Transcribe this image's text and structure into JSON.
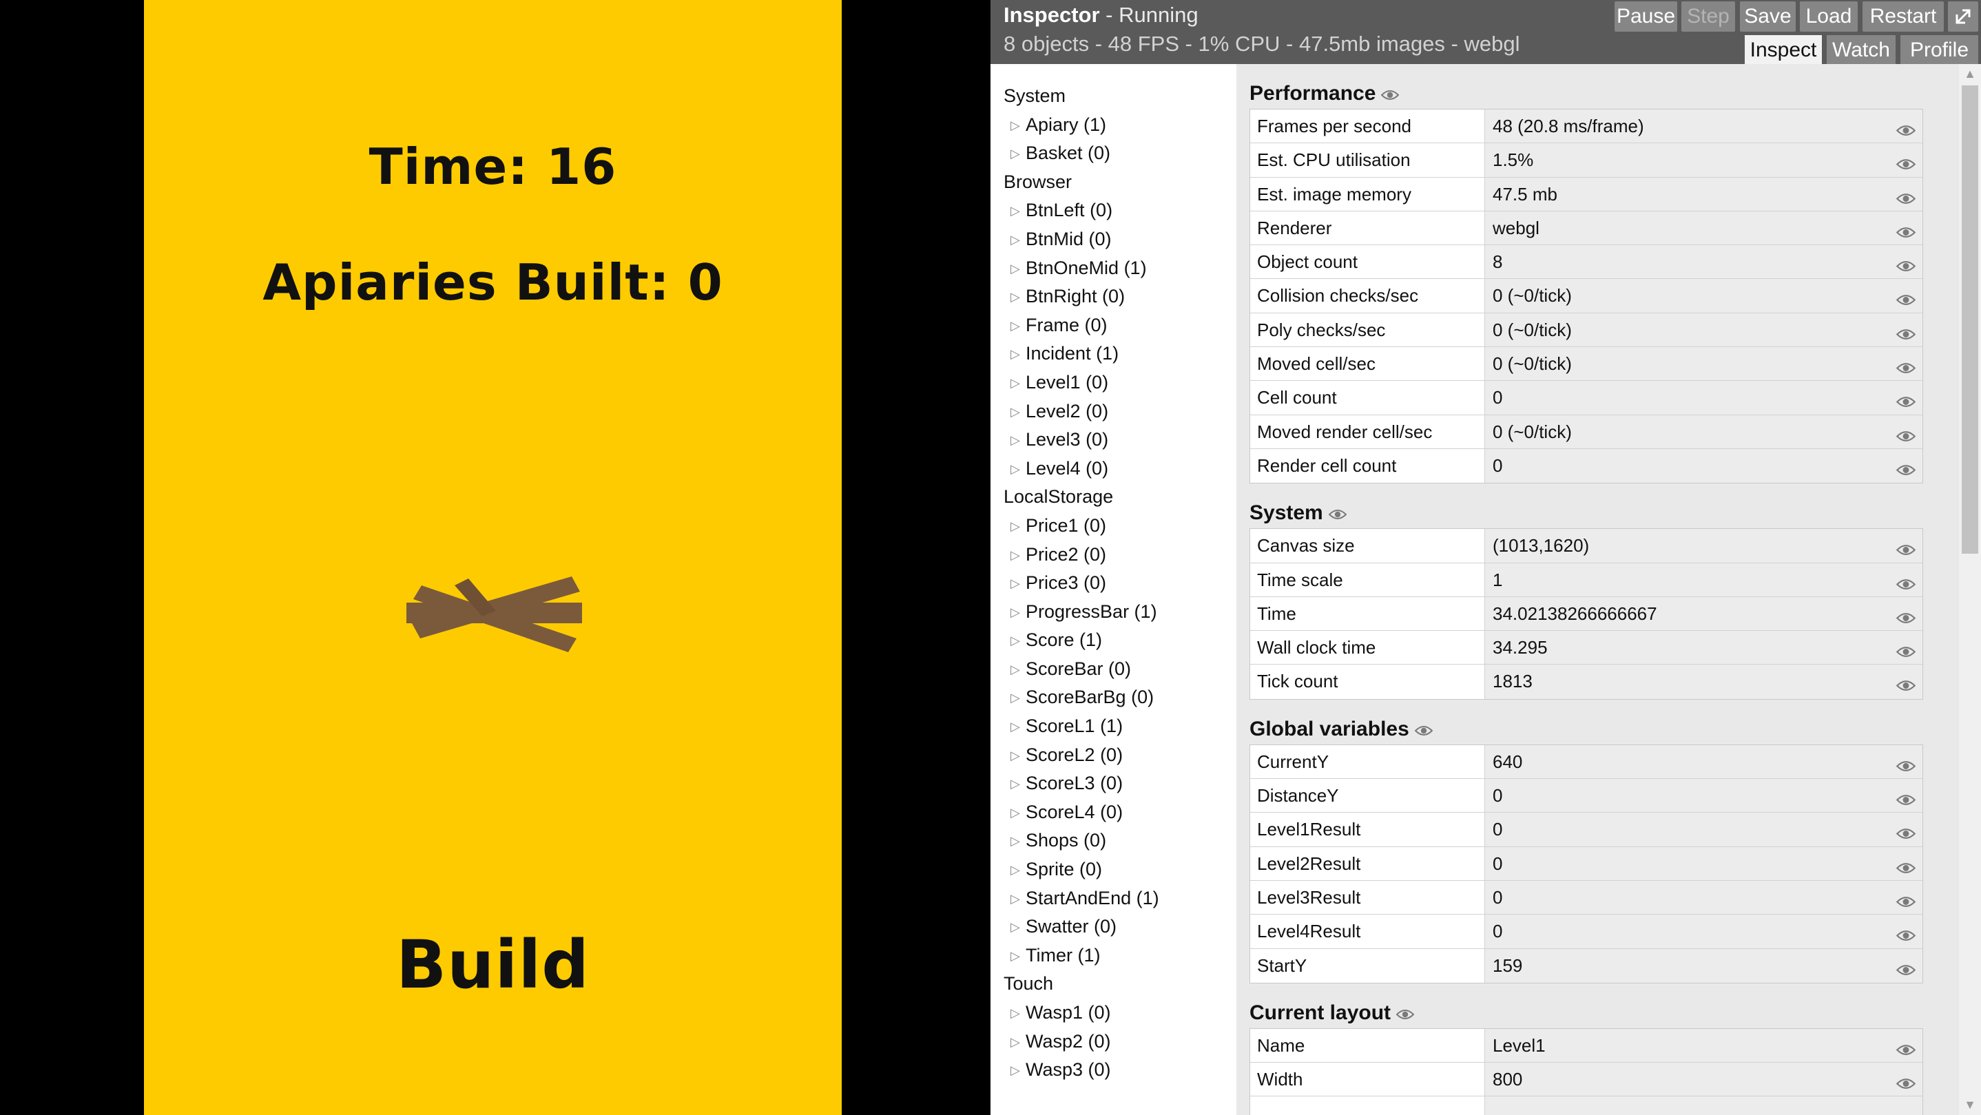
{
  "game": {
    "time_label": "Time: 16",
    "apiaries_label": "Apiaries Built: 0",
    "build_label": "Build",
    "background_color": "#fecb00"
  },
  "inspector": {
    "title_strong": "Inspector",
    "title_state": " - Running",
    "stats": "8 objects - 48 FPS - 1% CPU - 47.5mb images - webgl",
    "buttons": {
      "pause": "Pause",
      "step": "Step",
      "save": "Save",
      "load": "Load",
      "restart": "Restart",
      "popout_icon": "external-link-icon"
    },
    "tabs": {
      "inspect": "Inspect",
      "watch": "Watch",
      "profile": "Profile"
    }
  },
  "object_tree": [
    {
      "group": "System",
      "items": [
        "Apiary (1)",
        "Basket (0)"
      ]
    },
    {
      "group": "Browser",
      "items": [
        "BtnLeft (0)",
        "BtnMid (0)",
        "BtnOneMid (1)",
        "BtnRight (0)",
        "Frame (0)",
        "Incident (1)",
        "Level1 (0)",
        "Level2 (0)",
        "Level3 (0)",
        "Level4 (0)"
      ]
    },
    {
      "group": "LocalStorage",
      "items": [
        "Price1 (0)",
        "Price2 (0)",
        "Price3 (0)",
        "ProgressBar (1)",
        "Score (1)",
        "ScoreBar (0)",
        "ScoreBarBg (0)",
        "ScoreL1 (1)",
        "ScoreL2 (0)",
        "ScoreL3 (0)",
        "ScoreL4 (0)",
        "Shops (0)",
        "Sprite (0)",
        "StartAndEnd (1)",
        "Swatter (0)",
        "Timer (1)"
      ]
    },
    {
      "group": "Touch",
      "items": [
        "Wasp1 (0)",
        "Wasp2 (0)",
        "Wasp3 (0)"
      ]
    }
  ],
  "sections": [
    {
      "title": "Performance",
      "rows": [
        [
          "Frames per second",
          "48 (20.8 ms/frame)"
        ],
        [
          "Est. CPU utilisation",
          "1.5%"
        ],
        [
          "Est. image memory",
          "47.5 mb"
        ],
        [
          "Renderer",
          "webgl"
        ],
        [
          "Object count",
          "8"
        ],
        [
          "Collision checks/sec",
          "0 (~0/tick)"
        ],
        [
          "Poly checks/sec",
          "0 (~0/tick)"
        ],
        [
          "Moved cell/sec",
          "0 (~0/tick)"
        ],
        [
          "Cell count",
          "0"
        ],
        [
          "Moved render cell/sec",
          "0 (~0/tick)"
        ],
        [
          "Render cell count",
          "0"
        ]
      ]
    },
    {
      "title": "System",
      "rows": [
        [
          "Canvas size",
          "(1013,1620)"
        ],
        [
          "Time scale",
          "1"
        ],
        [
          "Time",
          "34.02138266666667"
        ],
        [
          "Wall clock time",
          "34.295"
        ],
        [
          "Tick count",
          "1813"
        ]
      ]
    },
    {
      "title": "Global variables",
      "rows": [
        [
          "CurrentY",
          "640"
        ],
        [
          "DistanceY",
          "0"
        ],
        [
          "Level1Result",
          "0"
        ],
        [
          "Level2Result",
          "0"
        ],
        [
          "Level3Result",
          "0"
        ],
        [
          "Level4Result",
          "0"
        ],
        [
          "StartY",
          "159"
        ]
      ]
    },
    {
      "title": "Current layout",
      "rows": [
        [
          "Name",
          "Level1"
        ],
        [
          "Width",
          "800"
        ],
        [
          "",
          ""
        ]
      ]
    }
  ]
}
